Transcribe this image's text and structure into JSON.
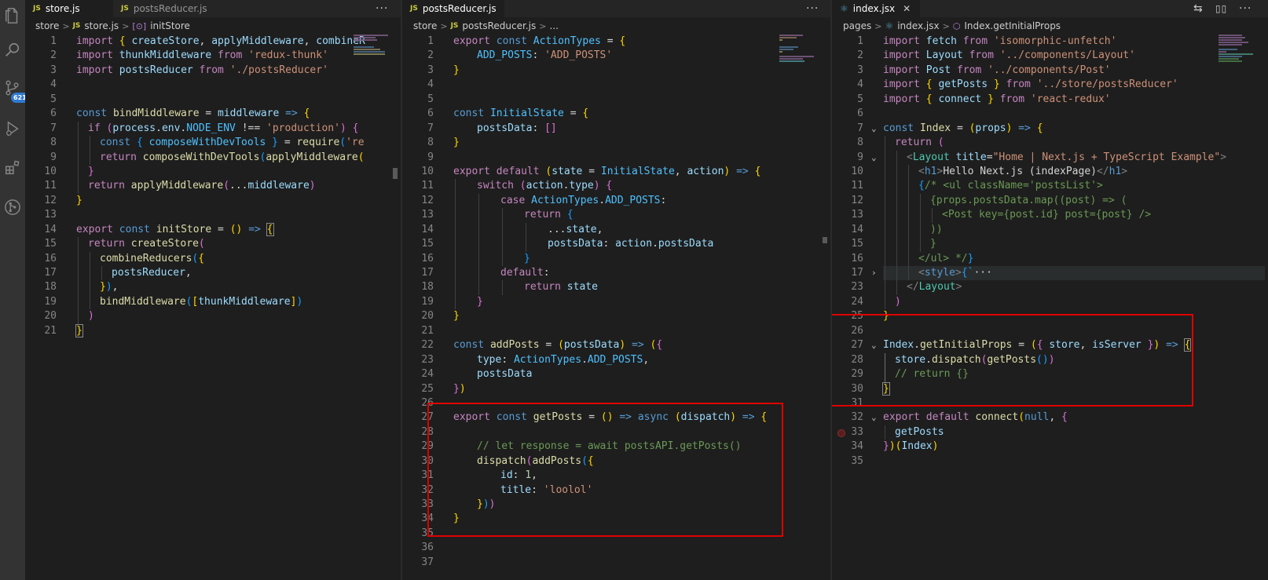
{
  "activity_bar": {
    "icons": [
      "files-icon",
      "search-icon",
      "source-control-icon",
      "run-debug-icon",
      "extensions-icon",
      "git-graph-icon"
    ],
    "scm_badge": "621"
  },
  "panes": {
    "store": {
      "tabs": [
        {
          "label": "store.js",
          "active": true
        },
        {
          "label": "postsReducer.js",
          "active": false
        }
      ],
      "breadcrumb": [
        "store",
        "store.js",
        "initStore"
      ],
      "lines": [
        "1",
        "2",
        "3",
        "4",
        "5",
        "6",
        "7",
        "8",
        "9",
        "10",
        "11",
        "12",
        "13",
        "14",
        "15",
        "16",
        "17",
        "18",
        "19",
        "20",
        "21"
      ],
      "code": {
        "l1a": "import",
        "l1b": "{ ",
        "l1c": "createStore",
        "l1d": ", ",
        "l1e": "applyMiddleware",
        "l1f": ", ",
        "l1g": "combineR",
        "l2a": "import",
        "l2b": "thunkMiddleware",
        "l2c": "from",
        "l2d": "'redux-thunk'",
        "l3a": "import",
        "l3b": "postsReducer",
        "l3c": "from",
        "l3d": "'./postsReducer'",
        "l6a": "const",
        "l6b": "bindMiddleware",
        "l6c": "=",
        "l6d": "middleware",
        "l6e": "=>",
        "l6f": "{",
        "l7a": "if",
        "l7b": "(",
        "l7c": "process",
        "l7d": ".",
        "l7e": "env",
        "l7f": ".",
        "l7g": "NODE_ENV",
        "l7h": "!==",
        "l7i": "'production'",
        "l7j": ")",
        "l7k": "{",
        "l8a": "const",
        "l8b": "{ ",
        "l8c": "composeWithDevTools",
        "l8d": " }",
        "l8e": "=",
        "l8f": "require",
        "l8g": "(",
        "l8h": "'re",
        "l9a": "return",
        "l9b": "composeWithDevTools",
        "l9c": "(",
        "l9d": "applyMiddleware",
        "l9e": "(",
        "l10a": "}",
        "l11a": "return",
        "l11b": "applyMiddleware",
        "l11c": "(",
        "l11d": "...",
        "l11e": "middleware",
        "l11f": ")",
        "l12a": "}",
        "l14a": "export",
        "l14b": "const",
        "l14c": "initStore",
        "l14d": "=",
        "l14e": "()",
        "l14f": "=>",
        "l14g": "{",
        "l15a": "return",
        "l15b": "createStore",
        "l15c": "(",
        "l16a": "combineReducers",
        "l16b": "(",
        "l16c": "{",
        "l17a": "postsReducer",
        "l17b": ",",
        "l18a": "}",
        "l18b": ")",
        "l18c": ",",
        "l19a": "bindMiddleware",
        "l19b": "(",
        "l19c": "[",
        "l19d": "thunkMiddleware",
        "l19e": "]",
        "l19f": ")",
        "l20a": ")",
        "l21a": "}"
      }
    },
    "reducer": {
      "tabs": [
        {
          "label": "postsReducer.js",
          "active": true
        }
      ],
      "breadcrumb": [
        "store",
        "postsReducer.js",
        "..."
      ],
      "lines": [
        "1",
        "2",
        "3",
        "4",
        "5",
        "6",
        "7",
        "8",
        "9",
        "10",
        "11",
        "12",
        "13",
        "14",
        "15",
        "16",
        "17",
        "18",
        "19",
        "20",
        "21",
        "22",
        "23",
        "24",
        "25",
        "26",
        "27",
        "28",
        "29",
        "30",
        "31",
        "32",
        "33",
        "34",
        "35",
        "36",
        "37"
      ],
      "code": {
        "l1a": "export",
        "l1b": "const",
        "l1c": "ActionTypes",
        "l1d": "=",
        "l1e": "{",
        "l2a": "ADD_POSTS",
        "l2b": ":",
        "l2c": "'ADD_POSTS'",
        "l3a": "}",
        "l6a": "const",
        "l6b": "InitialState",
        "l6c": "=",
        "l6d": "{",
        "l7a": "postsData",
        "l7b": ":",
        "l7c": "[]",
        "l8a": "}",
        "l10a": "export",
        "l10b": "default",
        "l10c": "(",
        "l10d": "state",
        "l10e": "=",
        "l10f": "InitialState",
        "l10g": ",",
        "l10h": "action",
        "l10i": ")",
        "l10j": "=>",
        "l10k": "{",
        "l11a": "switch",
        "l11b": "(",
        "l11c": "action",
        "l11d": ".",
        "l11e": "type",
        "l11f": ")",
        "l11g": "{",
        "l12a": "case",
        "l12b": "ActionTypes",
        "l12c": ".",
        "l12d": "ADD_POSTS",
        "l12e": ":",
        "l13a": "return",
        "l13b": "{",
        "l14a": "...",
        "l14b": "state",
        "l14c": ",",
        "l15a": "postsData",
        "l15b": ":",
        "l15c": "action",
        "l15d": ".",
        "l15e": "postsData",
        "l16a": "}",
        "l17a": "default",
        "l17b": ":",
        "l18a": "return",
        "l18b": "state",
        "l19a": "}",
        "l20a": "}",
        "l22a": "const",
        "l22b": "addPosts",
        "l22c": "=",
        "l22d": "(",
        "l22e": "postsData",
        "l22f": ")",
        "l22g": "=>",
        "l22h": "(",
        "l22i": "{",
        "l23a": "type",
        "l23b": ":",
        "l23c": "ActionTypes",
        "l23d": ".",
        "l23e": "ADD_POSTS",
        "l23f": ",",
        "l24a": "postsData",
        "l25a": "}",
        "l25b": ")",
        "l27a": "export",
        "l27b": "const",
        "l27c": "getPosts",
        "l27d": "=",
        "l27e": "()",
        "l27f": "=>",
        "l27g": "async",
        "l27h": "(",
        "l27i": "dispatch",
        "l27j": ")",
        "l27k": "=>",
        "l27l": "{",
        "l29a": "// let response = await postsAPI.getPosts()",
        "l30a": "dispatch",
        "l30b": "(",
        "l30c": "addPosts",
        "l30d": "(",
        "l30e": "{",
        "l31a": "id",
        "l31b": ":",
        "l31c": "1",
        "l31d": ",",
        "l32a": "title",
        "l32b": ":",
        "l32c": "'loolol'",
        "l33a": "}",
        "l33b": ")",
        "l33c": ")",
        "l34a": "}"
      }
    },
    "index": {
      "tabs": [
        {
          "label": "index.jsx",
          "active": true
        }
      ],
      "breadcrumb": [
        "pages",
        "index.jsx",
        "Index.getInitialProps"
      ],
      "lines": [
        "1",
        "2",
        "3",
        "4",
        "5",
        "6",
        "7",
        "8",
        "9",
        "10",
        "11",
        "12",
        "13",
        "14",
        "15",
        "16",
        "17",
        "23",
        "24",
        "25",
        "26",
        "27",
        "28",
        "29",
        "30",
        "31",
        "32",
        "33",
        "34",
        "35"
      ],
      "code": {
        "l1a": "import",
        "l1b": "fetch",
        "l1c": "from",
        "l1d": "'isomorphic-unfetch'",
        "l2a": "import",
        "l2b": "Layout",
        "l2c": "from",
        "l2d": "'../components/Layout'",
        "l3a": "import",
        "l3b": "Post",
        "l3c": "from",
        "l3d": "'../components/Post'",
        "l4a": "import",
        "l4b": "{ ",
        "l4c": "getPosts",
        "l4d": " }",
        "l4e": "from",
        "l4f": "'../store/postsReducer'",
        "l5a": "import",
        "l5b": "{ ",
        "l5c": "connect",
        "l5d": " }",
        "l5e": "from",
        "l5f": "'react-redux'",
        "l7a": "const",
        "l7b": "Index",
        "l7c": "=",
        "l7d": "(",
        "l7e": "props",
        "l7f": ")",
        "l7g": "=>",
        "l7h": "{",
        "l8a": "return",
        "l8b": "(",
        "l9a": "<",
        "l9b": "Layout",
        "l9c": "title",
        "l9d": "=",
        "l9e": "\"Home | Next.js + TypeScript Example\"",
        "l9f": ">",
        "l10a": "<",
        "l10b": "h1",
        "l10c": ">",
        "l10d": "Hello Next.js (indexPage)",
        "l10e": "</",
        "l10f": "h1",
        "l10g": ">",
        "l11a": "{",
        "l11b": "/* <ul className='postsList'>",
        "l12a": "{props.postsData.map((post) => (",
        "l13a": "<Post key={post.id} post={post} />",
        "l14a": "))",
        "l15a": "}",
        "l16a": "</ul> */",
        "l16b": "}",
        "l17a": "<",
        "l17b": "style",
        "l17c": ">",
        "l17d": "{`",
        "l17e": "···",
        "l23a": "</",
        "l23b": "Layout",
        "l23c": ">",
        "l24a": ")",
        "l25a": "}",
        "l27a": "Index",
        "l27b": ".",
        "l27c": "getInitialProps",
        "l27d": "=",
        "l27e": "(",
        "l27f": "{ ",
        "l27g": "store",
        "l27h": ", ",
        "l27i": "isServer",
        "l27j": " }",
        "l27k": ")",
        "l27l": "=>",
        "l27m": "{",
        "l28a": "store",
        "l28b": ".",
        "l28c": "dispatch",
        "l28d": "(",
        "l28e": "getPosts",
        "l28f": "()",
        "l28g": ")",
        "l29a": "// return {}",
        "l30a": "}",
        "l32a": "export",
        "l32b": "default",
        "l32c": "connect",
        "l32d": "(",
        "l32e": "null",
        "l32f": ",",
        "l32g": "{",
        "l33a": "getPosts",
        "l34a": "}",
        "l34b": ")",
        "l34c": "(",
        "l34d": "Index",
        "l34e": ")"
      }
    }
  },
  "colors": {
    "annotation_box": "#e00000",
    "editor_bg": "#1e1e1e",
    "activity_bar_bg": "#333333"
  }
}
